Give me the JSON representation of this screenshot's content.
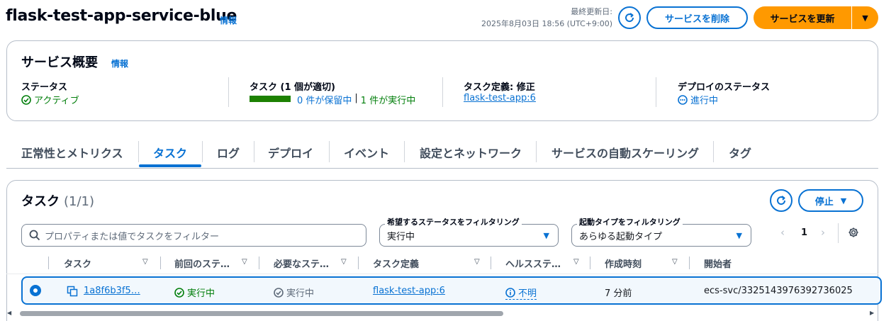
{
  "header": {
    "title": "flask-test-app-service-blue",
    "info": "情報",
    "last_updated_label": "最終更新日:",
    "last_updated_time": "2025年8月03日 18:56 (UTC+9:00)",
    "delete_label": "サービスを削除",
    "update_label": "サービスを更新"
  },
  "overview": {
    "title": "サービス概要",
    "info": "情報",
    "status_label": "ステータス",
    "status_value": "アクティブ",
    "tasks_label": "タスク (1 個が適切)",
    "tasks_pending": "0 件が保留中",
    "tasks_sep": "|",
    "tasks_running": "1 件が実行中",
    "tasks_progress_fraction": 1.0,
    "taskdef_label": "タスク定義: 修正",
    "taskdef_value": "flask-test-app:6",
    "deploy_label": "デプロイのステータス",
    "deploy_value": "進行中"
  },
  "tabs": [
    {
      "label": "正常性とメトリクス"
    },
    {
      "label": "タスク"
    },
    {
      "label": "ログ"
    },
    {
      "label": "デプロイ"
    },
    {
      "label": "イベント"
    },
    {
      "label": "設定とネットワーク"
    },
    {
      "label": "サービスの自動スケーリング"
    },
    {
      "label": "タグ"
    }
  ],
  "tasks_panel": {
    "title": "タスク",
    "count": "(1/1)",
    "stop_label": "停止",
    "search_placeholder": "プロパティまたは値でタスクをフィルター",
    "filter_status_label": "希望するステータスをフィルタリング",
    "filter_status_value": "実行中",
    "filter_launch_label": "起動タイプをフィルタリング",
    "filter_launch_value": "あらゆる起動タイプ",
    "page": "1",
    "columns": [
      "タスク",
      "前回のステ…",
      "必要なステ…",
      "タスク定義",
      "ヘルスステ…",
      "作成時刻",
      "開始者"
    ],
    "rows": [
      {
        "task": "1a8f6b3f5…",
        "last_status": "実行中",
        "desired_status": "実行中",
        "task_definition": "flask-test-app:6",
        "health": "不明",
        "created": "7 分前",
        "started_by": "ecs-svc/3325143976392736025"
      }
    ]
  },
  "colors": {
    "accent": "#0972d3",
    "primary_button": "#ff9900",
    "success": "#037f0c",
    "pending_grey": "#5f6b7a"
  }
}
